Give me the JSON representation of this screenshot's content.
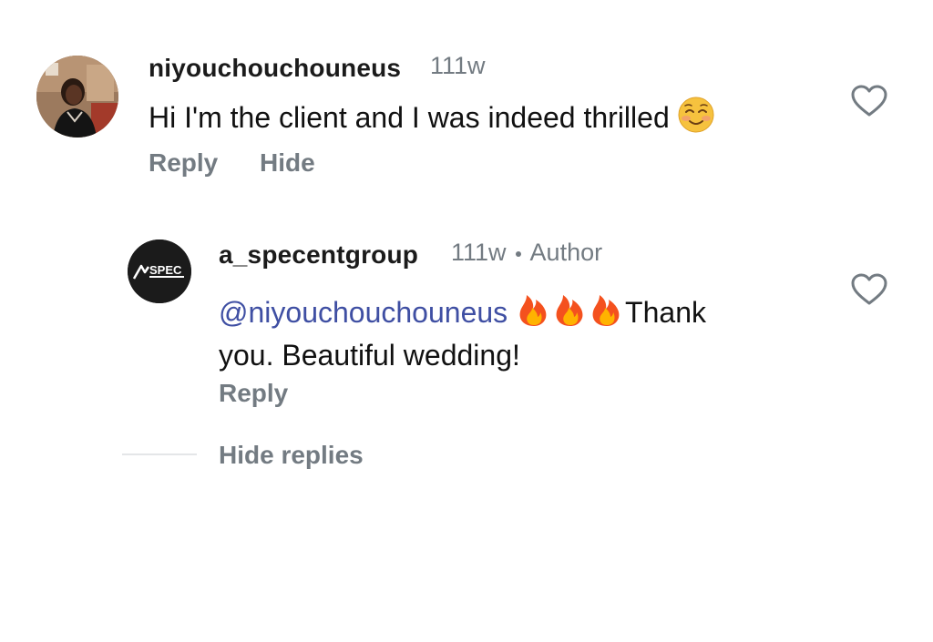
{
  "comments": [
    {
      "username": "niyouchouchouneus",
      "time": "111w",
      "text": "Hi I'm the client and I was indeed thrilled",
      "emoji": "relieved-smile-emoji",
      "actions": {
        "reply": "Reply",
        "hide": "Hide"
      }
    },
    {
      "username": "a_specentgroup",
      "time": "111w",
      "badge": "Author",
      "avatar_text": "SPEC",
      "mention": "@niyouchouchouneus",
      "text_after_mention": "Thank",
      "text_line2": "you. Beautiful wedding!",
      "emoji": "fire-emoji",
      "actions": {
        "reply": "Reply"
      }
    }
  ],
  "hide_replies": "Hide replies",
  "colors": {
    "muted": "#737b82",
    "mention": "#3f4fa3",
    "text": "#111111"
  }
}
